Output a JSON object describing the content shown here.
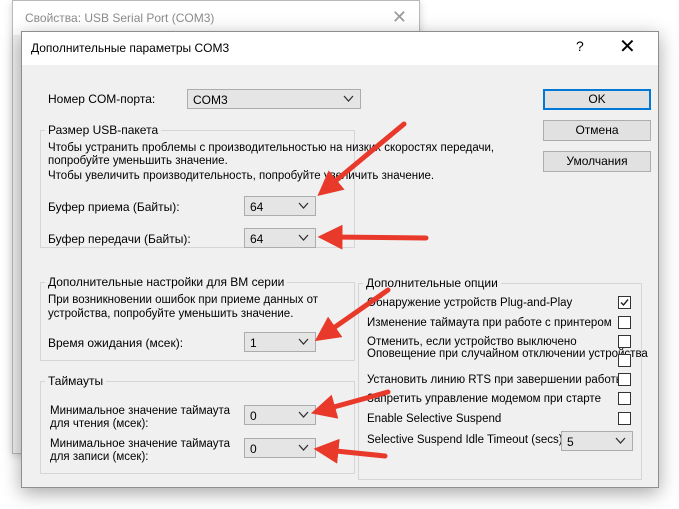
{
  "background_window": {
    "title": "Свойства: USB Serial Port (COM3)",
    "close_glyph": "✕"
  },
  "dialog": {
    "title": "Дополнительные параметры COM3",
    "help_glyph": "?",
    "close_glyph": "✕"
  },
  "com_port": {
    "label": "Номер COM-порта:",
    "value": "COM3"
  },
  "usb_packet": {
    "group_title": "Размер USB-пакета",
    "text_line1": "Чтобы устранить проблемы с производительностью на низких скоростях передачи,",
    "text_line2": "попробуйте уменьшить значение.",
    "text_line3": "Чтобы увеличить производительность, попробуйте увеличить значение.",
    "receive_label": "Буфер приема (Байты):",
    "receive_value": "64",
    "transmit_label": "Буфер передачи (Байты):",
    "transmit_value": "64"
  },
  "bm_settings": {
    "group_title": "Дополнительные настройки для BM серии",
    "text_line1": "При возникновении ошибок при приеме данных от",
    "text_line2": "устройства, попробуйте уменьшить значение.",
    "latency_label": "Время ожидания (мсек):",
    "latency_value": "1"
  },
  "timeouts": {
    "group_title": "Таймауты",
    "read_label_line1": "Минимальное значение таймаута",
    "read_label_line2": "для чтения (мсек):",
    "read_value": "0",
    "write_label_line1": "Минимальное значение таймаута",
    "write_label_line2": "для записи (мсек):",
    "write_value": "0"
  },
  "buttons": {
    "ok": "OK",
    "cancel": "Отмена",
    "defaults": "Умолчания"
  },
  "options": {
    "group_title": "Дополнительные опции",
    "items": [
      {
        "label": "Обнаружение устройств Plug-and-Play",
        "checked": true
      },
      {
        "label": "Изменение таймаута при работе с принтером",
        "checked": false
      },
      {
        "label": "Отменить, если устройство выключено",
        "checked": false
      },
      {
        "label": "Оповещение при случайном отключении устройства",
        "checked": false
      },
      {
        "label": "Установить линию RTS при завершении работы",
        "checked": false
      },
      {
        "label": "Запретить управление модемом при старте",
        "checked": false
      },
      {
        "label": "Enable Selective Suspend",
        "checked": false
      }
    ],
    "idle_timeout_label": "Selective Suspend Idle Timeout (secs):",
    "idle_timeout_value": "5"
  },
  "colors": {
    "accent": "#0078d7",
    "annotation_arrow": "#e8392a",
    "dialog_bg": "#f0f0f0"
  }
}
